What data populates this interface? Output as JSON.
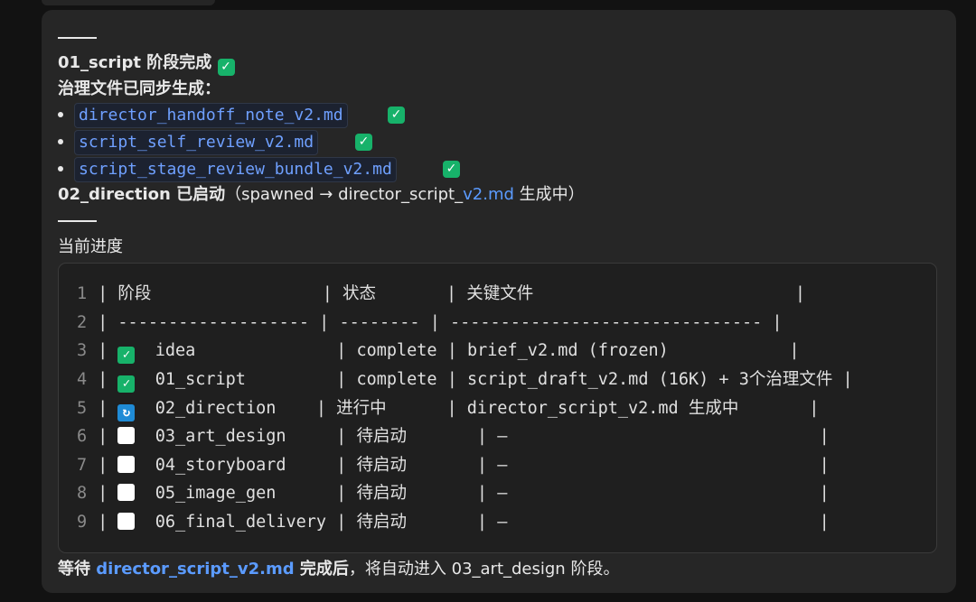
{
  "heading1": {
    "stage": "01_script 阶段完成",
    "check": "✓"
  },
  "governance": {
    "label": "治理文件已同步生成：",
    "files": [
      {
        "name": "director_handoff_note_v2.md",
        "check": "✓"
      },
      {
        "name": "script_self_review_v2.md",
        "check": "✓"
      },
      {
        "name": "script_stage_review_bundle_v2.md",
        "check": "✓"
      }
    ]
  },
  "heading2": {
    "stage": "02_direction 已启动",
    "paren_open": "（spawned → director_script_",
    "link": "v2.md",
    "paren_close": " 生成中）"
  },
  "progress_label": "当前进度",
  "table": {
    "lines": [
      {
        "n": "1",
        "text": " | 阶段                 | 状态       | 关键文件                          |"
      },
      {
        "n": "2",
        "text": " | ------------------- | -------- | ------------------------------- |"
      },
      {
        "n": "3",
        "pre": " | ",
        "box": "done",
        "text": "  idea              | complete | brief_v2.md (frozen)            |"
      },
      {
        "n": "4",
        "pre": " | ",
        "box": "done",
        "text": "  01_script         | complete | script_draft_v2.md (16K) + 3个治理文件 |"
      },
      {
        "n": "5",
        "pre": " | ",
        "box": "prog",
        "text": "  02_direction    | 进行中      | director_script_v2.md 生成中       |"
      },
      {
        "n": "6",
        "pre": " | ",
        "box": "todo",
        "text": "  03_art_design     | 待启动       | —                               |"
      },
      {
        "n": "7",
        "pre": " | ",
        "box": "todo",
        "text": "  04_storyboard     | 待启动       | —                               |"
      },
      {
        "n": "8",
        "pre": " | ",
        "box": "todo",
        "text": "  05_image_gen      | 待启动       | —                               |"
      },
      {
        "n": "9",
        "pre": " | ",
        "box": "todo",
        "text": "  06_final_delivery | 待启动       | —                               |"
      }
    ]
  },
  "footer": {
    "pre": "等待 ",
    "link": "director_script_v2.md",
    "mid": " 完成后",
    "post": "，将自动进入 03_art_design 阶段。"
  },
  "colors": {
    "panel": "#262626",
    "link": "#5b9bff",
    "check": "#17b26a",
    "progress": "#1f8bd6"
  }
}
